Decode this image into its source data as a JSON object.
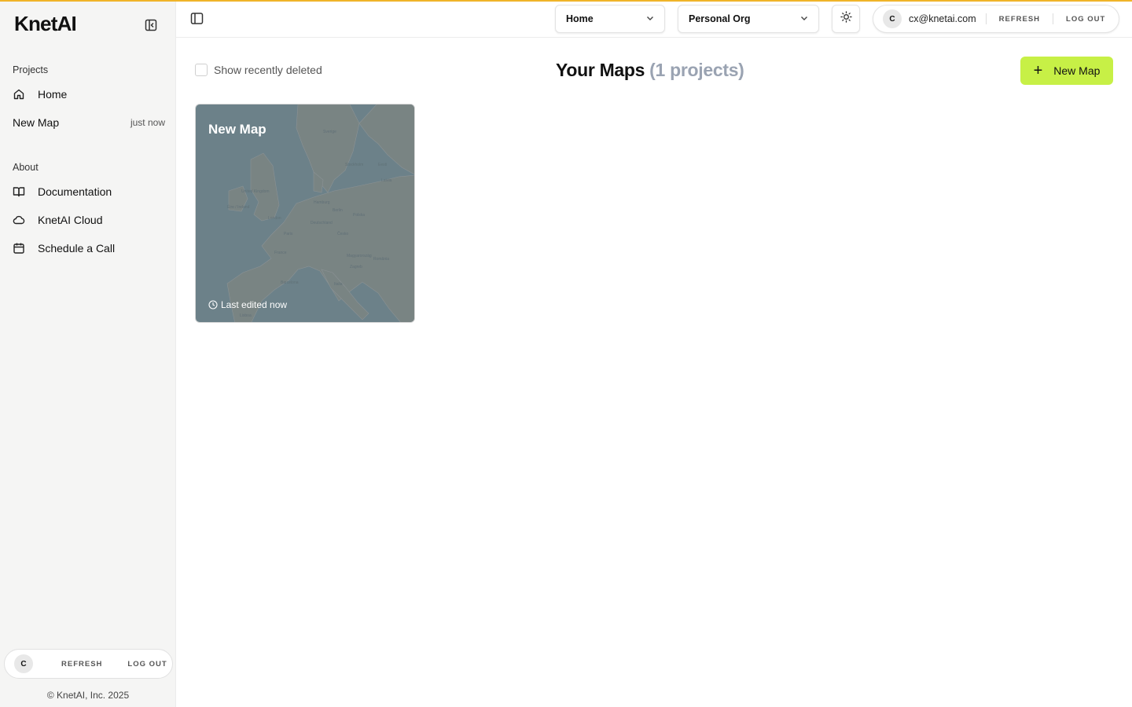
{
  "app": {
    "logo": "KnetAI"
  },
  "sidebar": {
    "projects_label": "Projects",
    "home_label": "Home",
    "recent": [
      {
        "name": "New Map",
        "when": "just now"
      }
    ],
    "about_label": "About",
    "about_items": [
      {
        "label": "Documentation",
        "icon": "book-icon"
      },
      {
        "label": "KnetAI Cloud",
        "icon": "cloud-icon"
      },
      {
        "label": "Schedule a Call",
        "icon": "calendar-icon"
      }
    ],
    "account": {
      "avatar_letter": "C",
      "refresh_label": "REFRESH",
      "logout_label": "LOG OUT"
    },
    "copyright": "© KnetAI, Inc. 2025"
  },
  "header": {
    "page_select": "Home",
    "org_select": "Personal Org",
    "account": {
      "avatar_letter": "C",
      "email": "cx@knetai.com",
      "refresh_label": "REFRESH",
      "logout_label": "LOG OUT"
    }
  },
  "main": {
    "show_deleted_label": "Show recently deleted",
    "title": "Your Maps",
    "count_text": "(1 projects)",
    "new_map_label": "New Map",
    "cards": [
      {
        "title": "New Map",
        "meta": "Last edited now"
      }
    ]
  },
  "colors": {
    "accent": "#c7f046",
    "top_bar": "#f0b429",
    "muted": "#9aa3b2"
  }
}
